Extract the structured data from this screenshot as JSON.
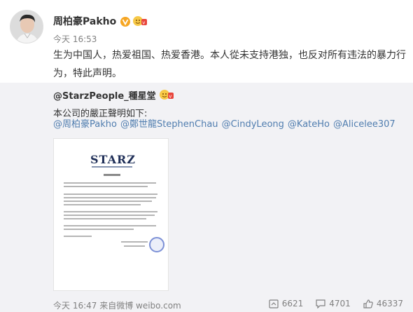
{
  "author": {
    "name": "周柏豪Pakho",
    "avatar": "avatar-photo",
    "verified_icon": "vip-v-icon",
    "badge_icon": "fan-badge-icon"
  },
  "post": {
    "time": "今天 16:53",
    "text": "生为中国人，热爱祖国、热爱香港。本人從未支持港独，也反对所有违法的暴力行为，特此声明。"
  },
  "repost": {
    "author": "@StarzPeople_種星堂",
    "badge_icon": "fan-badge-icon",
    "text": "本公司的嚴正聲明如下:",
    "mentions": [
      "@周柏豪Pakho",
      "@鄭世龍StephenChau",
      "@CindyLeong",
      "@KateHo",
      "@Alicelee307"
    ],
    "image": {
      "logo": "STARZ",
      "description": "document-image"
    },
    "footer": {
      "meta": "今天 16:47 来自微博 weibo.com"
    },
    "stats": {
      "shares": "6621",
      "comments": "4701",
      "likes": "46337"
    }
  },
  "colors": {
    "link": "#507daf",
    "repost_bg": "#f2f2f5",
    "meta": "#808080",
    "vip": "#f6a623"
  }
}
